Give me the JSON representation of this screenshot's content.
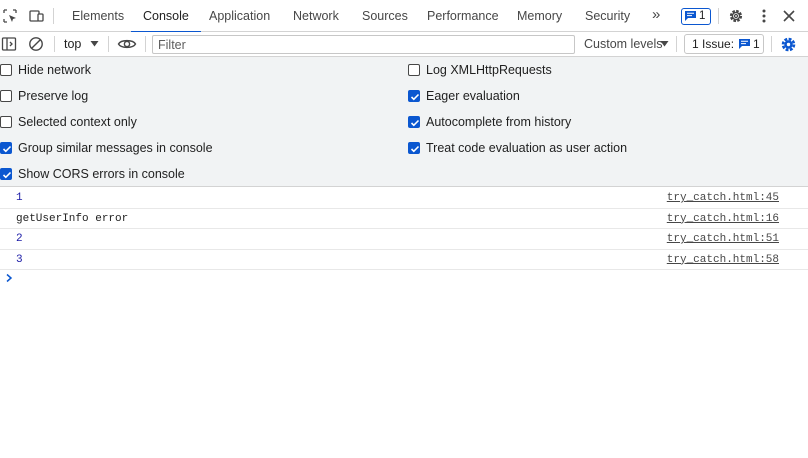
{
  "colors": {
    "accent": "#0b57d0",
    "number_value": "#1a1aa6",
    "settings_bg": "#f1f3f4",
    "border": "#d3d3d3"
  },
  "tabbar": {
    "left_icons": [
      "inspect-element-icon",
      "device-toolbar-icon"
    ],
    "tabs": [
      {
        "label": "Elements",
        "active": false
      },
      {
        "label": "Console",
        "active": true
      },
      {
        "label": "Application",
        "active": false
      },
      {
        "label": "Network",
        "active": false
      },
      {
        "label": "Sources",
        "active": false
      },
      {
        "label": "Performance",
        "active": false
      },
      {
        "label": "Memory",
        "active": false
      },
      {
        "label": "Security",
        "active": false
      }
    ],
    "more_tabs_glyph": "»",
    "messages_badge_count": "1",
    "right_icons": [
      "settings-gear-icon",
      "kebab-menu-icon",
      "close-icon"
    ]
  },
  "toolbar": {
    "context": "top",
    "filter_placeholder": "Filter",
    "levels_label": "Custom levels",
    "issues_label": "1 Issue:",
    "issues_count": "1"
  },
  "settings": {
    "left": [
      {
        "label": "Hide network",
        "checked": false
      },
      {
        "label": "Preserve log",
        "checked": false
      },
      {
        "label": "Selected context only",
        "checked": false
      },
      {
        "label": "Group similar messages in console",
        "checked": true
      },
      {
        "label": "Show CORS errors in console",
        "checked": true
      }
    ],
    "right": [
      {
        "label": "Log XMLHttpRequests",
        "checked": false
      },
      {
        "label": "Eager evaluation",
        "checked": true
      },
      {
        "label": "Autocomplete from history",
        "checked": true
      },
      {
        "label": "Treat code evaluation as user action",
        "checked": true
      }
    ]
  },
  "console": {
    "messages": [
      {
        "text": "1",
        "kind": "number",
        "source": "try_catch.html:45"
      },
      {
        "text": "getUserInfo error",
        "kind": "string",
        "source": "try_catch.html:16"
      },
      {
        "text": "2",
        "kind": "number",
        "source": "try_catch.html:51"
      },
      {
        "text": "3",
        "kind": "number",
        "source": "try_catch.html:58"
      }
    ]
  }
}
